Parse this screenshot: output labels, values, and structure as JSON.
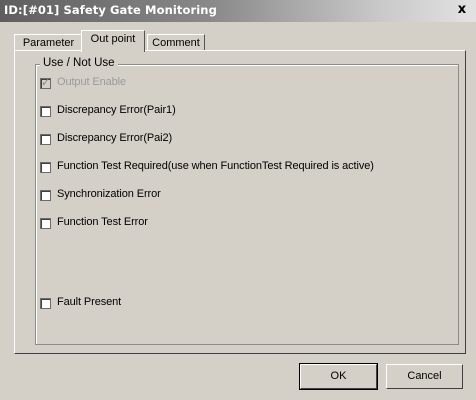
{
  "window": {
    "title": "ID:[#01]  Safety Gate Monitoring",
    "close_glyph": "x"
  },
  "tabs": [
    {
      "label": "Parameter",
      "active": false
    },
    {
      "label": "Out point",
      "active": true
    },
    {
      "label": "Comment",
      "active": false
    }
  ],
  "group": {
    "title": "Use / Not Use",
    "options": [
      {
        "label": "Output Enable",
        "checked": true,
        "disabled": true
      },
      {
        "label": "Discrepancy Error(Pair1)",
        "checked": false,
        "disabled": false
      },
      {
        "label": "Discrepancy Error(Pai2)",
        "checked": false,
        "disabled": false
      },
      {
        "label": "Function Test Required(use when FunctionTest Required is active)",
        "checked": false,
        "disabled": false
      },
      {
        "label": "Synchronization Error",
        "checked": false,
        "disabled": false
      },
      {
        "label": "Function Test Error",
        "checked": false,
        "disabled": false
      },
      {
        "label": "Fault Present",
        "checked": false,
        "disabled": false
      }
    ]
  },
  "buttons": {
    "ok_label": "OK",
    "cancel_label": "Cancel"
  }
}
